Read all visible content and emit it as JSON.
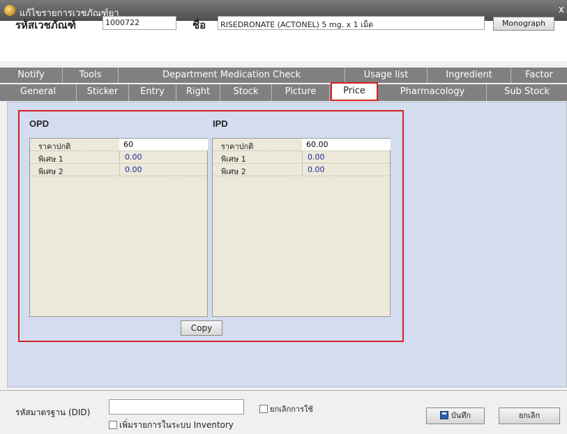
{
  "window": {
    "title": "แก้ไขรายการเวชภัณฑ์ยา",
    "close_glyph": "x"
  },
  "header": {
    "code_label": "รหัสเวชภัณฑ์",
    "code_value": "1000722",
    "name_label": "ชื่อ",
    "name_value": "RISEDRONATE (ACTONEL) 5 mg. x 1 เม็ด",
    "monograph_label": "Monograph"
  },
  "tabs_row1": [
    "Notify",
    "Tools",
    "Department Medication Check",
    "Usage list",
    "Ingredient",
    "Factor"
  ],
  "tabs_row2": [
    "General",
    "Sticker",
    "Entry",
    "Right",
    "Stock",
    "Picture",
    "Price",
    "Pharmacology",
    "Sub Stock"
  ],
  "active_tab": "Price",
  "opd": {
    "title": "OPD",
    "rows": [
      {
        "label": "ราคาปกติ",
        "value": "60"
      },
      {
        "label": "พิเศษ 1",
        "value": "0.00"
      },
      {
        "label": "พิเศษ 2",
        "value": "0.00"
      }
    ]
  },
  "ipd": {
    "title": "IPD",
    "rows": [
      {
        "label": "ราคาปกติ",
        "value": "60.00"
      },
      {
        "label": "พิเศษ 1",
        "value": "0.00"
      },
      {
        "label": "พิเศษ 2",
        "value": "0.00"
      }
    ]
  },
  "copy_label": "Copy",
  "footer": {
    "did_label": "รหัสมาตรฐาน (DID)",
    "did_value": "",
    "cancel_use_label": "ยกเลิกการใช้",
    "add_inventory_label": "เพิ่มรายการในระบบ Inventory",
    "save_label": "บันทึก",
    "cancel_label": "ยกเลิก"
  },
  "colors": {
    "highlight": "#d42020",
    "content_bg": "#d4dcf0",
    "grid_bg": "#ece8da",
    "value_text": "#1a2a9a"
  }
}
